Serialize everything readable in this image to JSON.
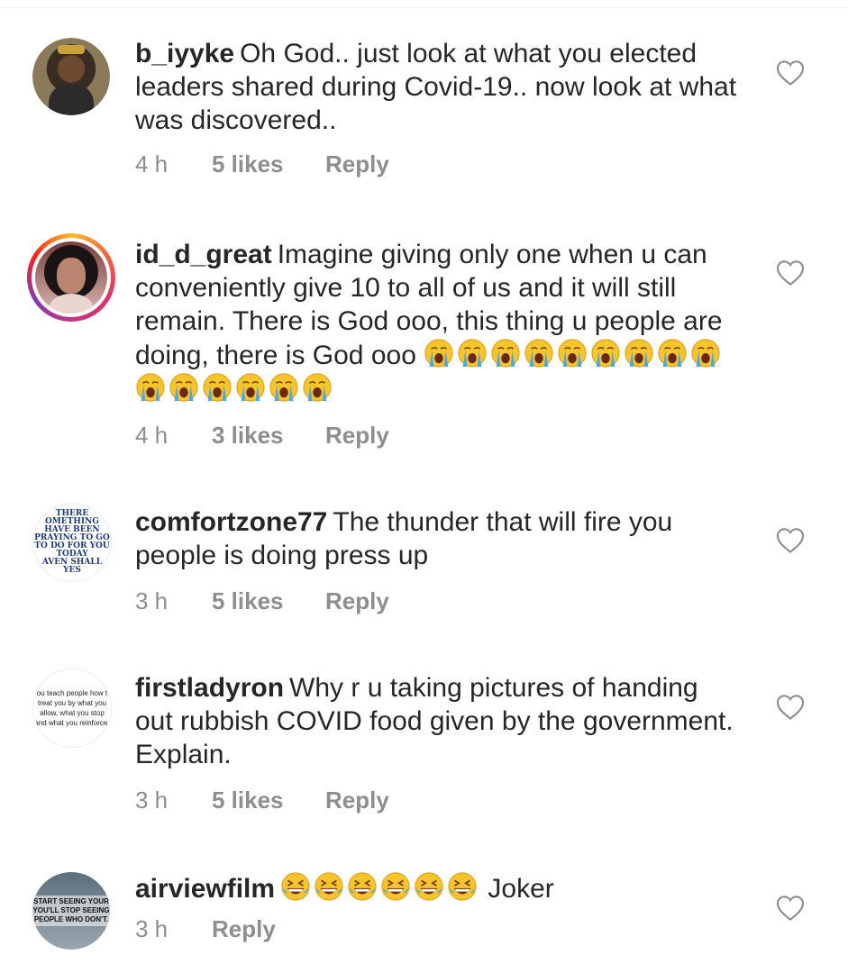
{
  "comments": [
    {
      "username": "b_iyyke",
      "text": "Oh God.. just look at what you elected leaders shared during Covid-19.. now look at what was discovered..",
      "time": "4 h",
      "likes": "5 likes",
      "reply": "Reply",
      "avatar_icon": "person-photo"
    },
    {
      "username": "id_d_great",
      "text": "Imagine giving only one when u can conveniently give 10 to all of us and it will still remain. There is God ooo, this thing u people are doing, there is God ooo",
      "emoji_count": 15,
      "emoji_icon": "loudly-crying-face",
      "time": "4 h",
      "likes": "3 likes",
      "reply": "Reply",
      "avatar_icon": "person-photo-story-ring"
    },
    {
      "username": "comfortzone77",
      "text": "The thunder that will fire you people is doing press up",
      "time": "3 h",
      "likes": "5 likes",
      "reply": "Reply",
      "avatar_icon": "quote-image"
    },
    {
      "username": "firstladyron",
      "text": "Why r u taking pictures of handing out rubbish COVID food given by the government. Explain.",
      "time": "3 h",
      "likes": "5 likes",
      "reply": "Reply",
      "avatar_icon": "quote-image"
    },
    {
      "username": "airviewfilm",
      "text": "Joker",
      "emoji_count": 6,
      "emoji_icon": "grinning-squinting-face",
      "time": "3 h",
      "reply": "Reply",
      "avatar_icon": "quote-image"
    }
  ],
  "avatar_text": {
    "comfortzone77": [
      "THERE",
      "OMETHING",
      "HAVE BEEN",
      "PRAYING TO GO",
      "TO DO FOR YOU",
      "TODAY",
      "AVEN SHALL",
      "YES"
    ],
    "firstladyron": [
      "ou teach people how t",
      "treat you by what you",
      "allow, what you stop",
      "and what you reinforce."
    ],
    "airviewfilm": [
      "START SEEING YOUR",
      "YOU'LL STOP SEEING",
      "PEOPLE WHO DON'T."
    ]
  },
  "colors": {
    "text": "#262626",
    "meta": "#8e8e8e",
    "heart": "#8e8e8e"
  }
}
